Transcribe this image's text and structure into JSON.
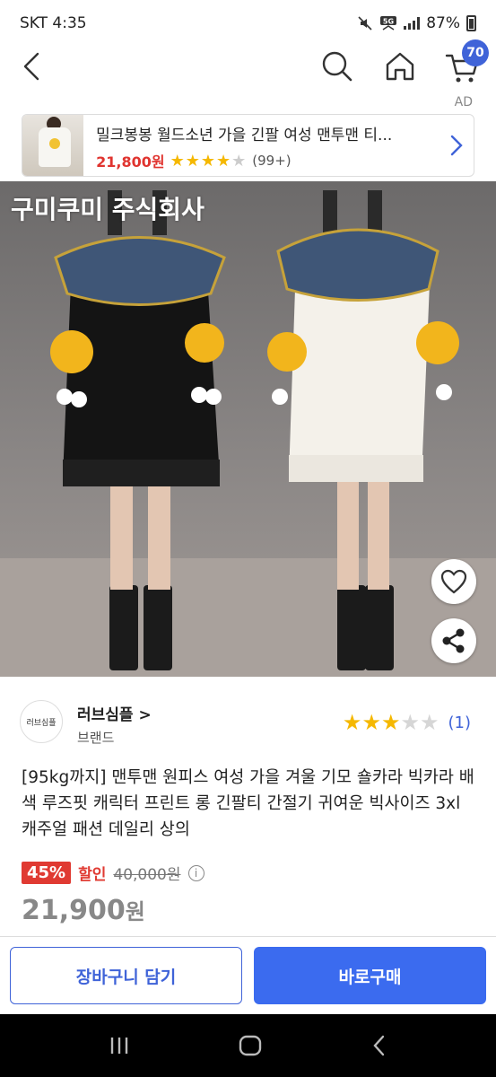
{
  "status_bar": {
    "carrier_time": "SKT 4:35",
    "battery": "87%",
    "network": "5G"
  },
  "header": {
    "cart_count": "70"
  },
  "ad": {
    "label": "AD",
    "title": "밀크봉봉 월드소년 가을 긴팔 여성 맨투맨 티...",
    "price": "21,800원",
    "rating_stars": 4,
    "review_count": "(99+)"
  },
  "photo": {
    "watermark": "구미쿠미 주식회사"
  },
  "store": {
    "logo_text": "러브심플",
    "name": "러브심플",
    "sub": "브랜드",
    "rating_stars": 3,
    "review_count": "(1)"
  },
  "product": {
    "title": "[95kg까지] 맨투맨 원피스 여성 가을 겨울 기모 숄카라 빅카라 배색 루즈핏 캐릭터 프린트 롱 긴팔티 간절기 귀여운 빅사이즈 3xl 캐주얼 패션 데일리 상의",
    "discount_pct": "45%",
    "discount_word": "할인",
    "original_price": "40,000원",
    "price": "21,900",
    "price_unit": "원"
  },
  "actions": {
    "cart_label": "장바구니 담기",
    "buy_label": "바로구매"
  },
  "colors": {
    "accent": "#3f63d8",
    "sale": "#e03a32",
    "star": "#f5b800"
  }
}
